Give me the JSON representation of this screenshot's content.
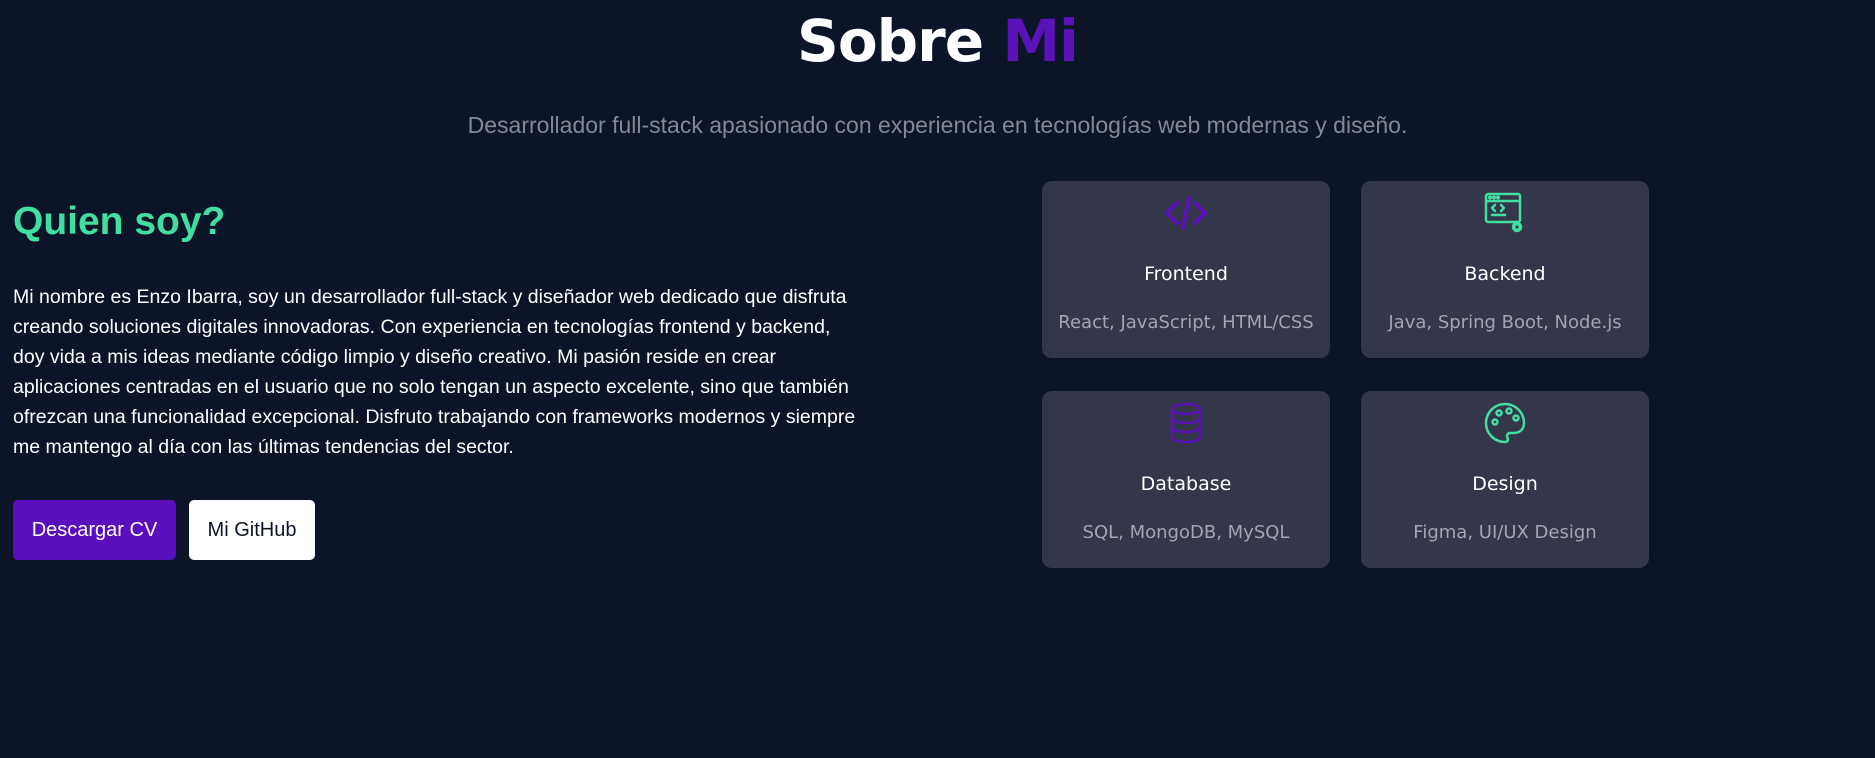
{
  "header": {
    "title_main": "Sobre",
    "title_accent": "Mi",
    "subtitle": "Desarrollador full-stack apasionado con experiencia en tecnologías web modernas y diseño."
  },
  "about": {
    "heading": "Quien soy?",
    "bio": "Mi nombre es Enzo Ibarra, soy un desarrollador full-stack y diseñador web dedicado que disfruta creando soluciones digitales innovadoras. Con experiencia en tecnologías frontend y backend, doy vida a mis ideas mediante código limpio y diseño creativo. Mi pasión reside en crear aplicaciones centradas en el usuario que no solo tengan un aspecto excelente, sino que también ofrezcan una funcionalidad excepcional. Disfruto trabajando con frameworks modernos y siempre me mantengo al día con las últimas tendencias del sector.",
    "buttons": {
      "download_cv": "Descargar CV",
      "github": "Mi GitHub"
    }
  },
  "skills": [
    {
      "title": "Frontend",
      "description": "React, JavaScript, HTML/CSS",
      "icon": "code-icon",
      "icon_color": "#5b12b8"
    },
    {
      "title": "Backend",
      "description": "Java, Spring Boot, Node.js",
      "icon": "server-code-icon",
      "icon_color": "#40dea0"
    },
    {
      "title": "Database",
      "description": "SQL, MongoDB, MySQL",
      "icon": "database-icon",
      "icon_color": "#5b12b8"
    },
    {
      "title": "Design",
      "description": "Figma, UI/UX Design",
      "icon": "palette-icon",
      "icon_color": "#40dea0"
    }
  ],
  "colors": {
    "background": "#0c1527",
    "accent_purple": "#5b12b8",
    "accent_green": "#40dea0",
    "card_background": "#343649"
  }
}
